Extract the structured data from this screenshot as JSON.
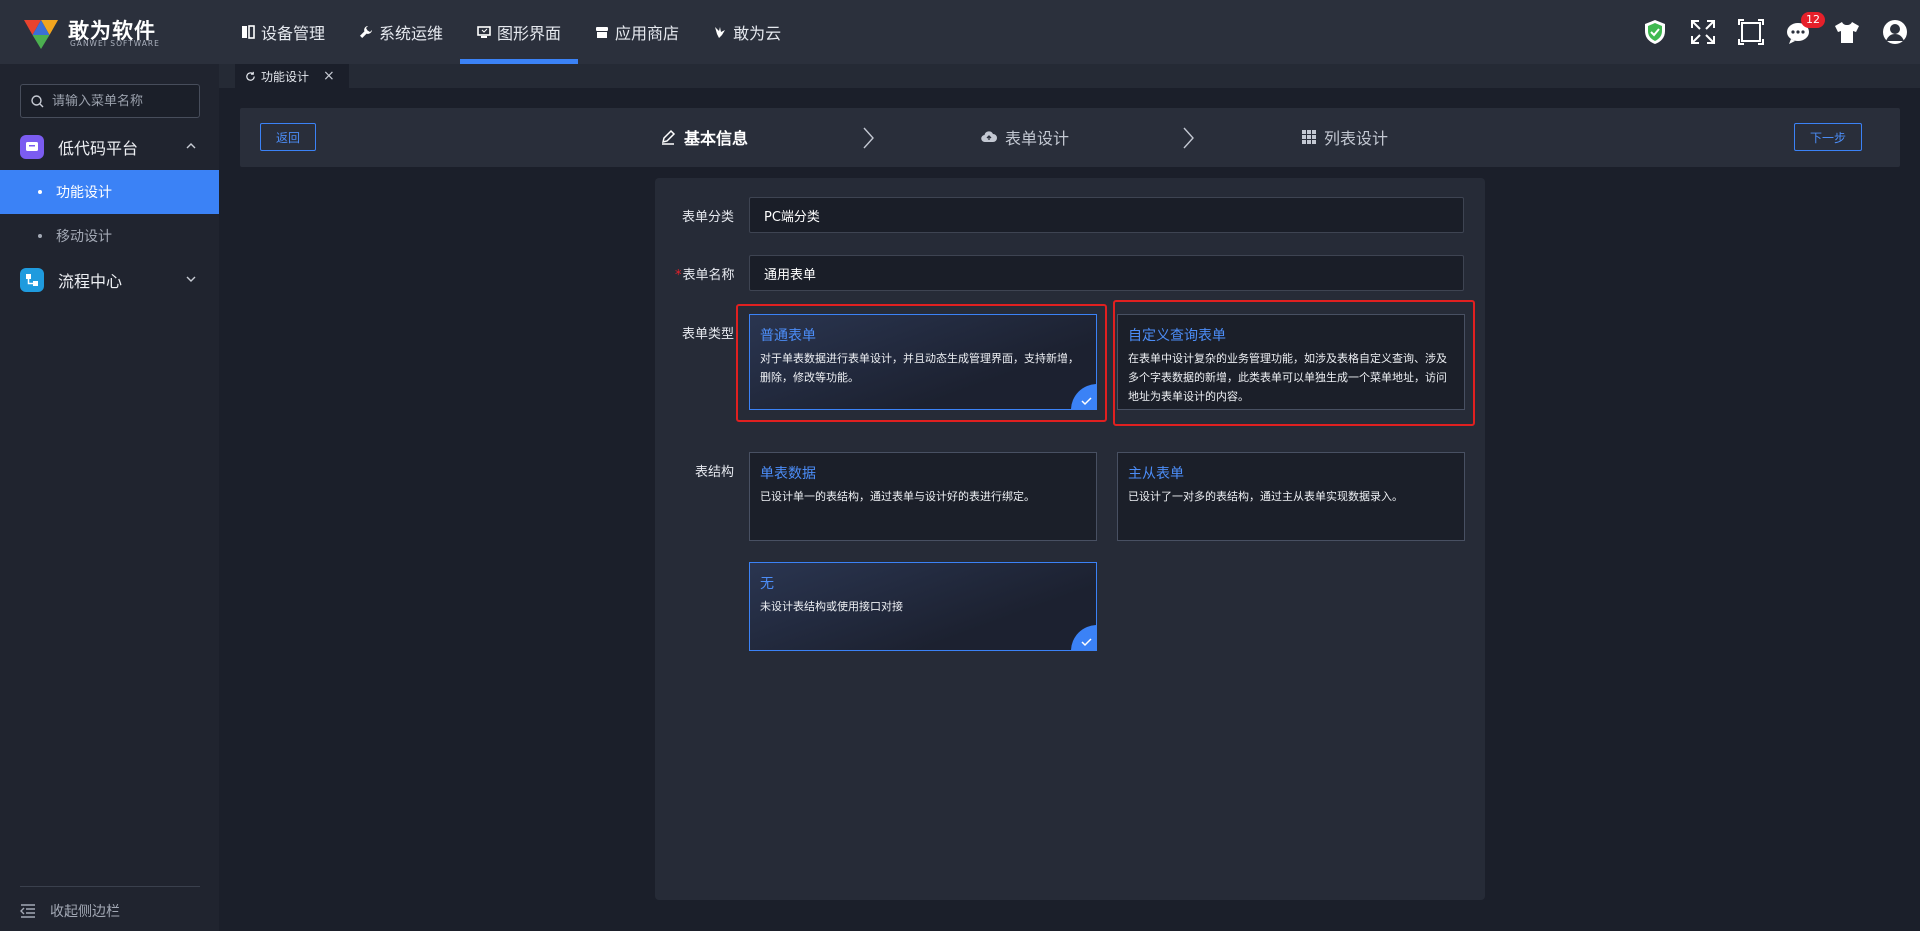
{
  "brand": {
    "name": "敢为软件",
    "sub": "GANWEI SOFTWARE"
  },
  "nav": [
    {
      "label": "设备管理",
      "icon": "book-icon"
    },
    {
      "label": "系统运维",
      "icon": "wrench-icon"
    },
    {
      "label": "图形界面",
      "icon": "monitor-icon",
      "active": true
    },
    {
      "label": "应用商店",
      "icon": "store-icon"
    },
    {
      "label": "敢为云",
      "icon": "bird-icon"
    }
  ],
  "tools": {
    "notification_count": "12"
  },
  "sidebar": {
    "search_placeholder": "请输入菜单名称",
    "groups": [
      {
        "label": "低代码平台",
        "expanded": true,
        "items": [
          "功能设计",
          "移动设计"
        ]
      },
      {
        "label": "流程中心",
        "expanded": false
      }
    ],
    "collapse_label": "收起侧边栏"
  },
  "tabs": [
    {
      "label": "功能设计"
    }
  ],
  "steps": {
    "back_label": "返回",
    "next_label": "下一步",
    "items": [
      "基本信息",
      "表单设计",
      "列表设计"
    ]
  },
  "form": {
    "category_label": "表单分类",
    "category_value": "PC端分类",
    "name_label": "表单名称",
    "name_required": "*",
    "name_value": "通用表单",
    "type_label": "表单类型",
    "types": [
      {
        "title": "普通表单",
        "desc": "对于单表数据进行表单设计，并且动态生成管理界面，支持新增，删除，修改等功能。",
        "selected": true
      },
      {
        "title": "自定义查询表单",
        "desc": "在表单中设计复杂的业务管理功能，如涉及表格自定义查询、涉及多个字表数据的新增，此类表单可以单独生成一个菜单地址，访问地址为表单设计的内容。",
        "selected": false
      }
    ],
    "structure_label": "表结构",
    "structures": [
      {
        "title": "单表数据",
        "desc": "已设计单一的表结构，通过表单与设计好的表进行绑定。",
        "selected": false
      },
      {
        "title": "主从表单",
        "desc": "已设计了一对多的表结构，通过主从表单实现数据录入。",
        "selected": false
      },
      {
        "title": "无",
        "desc": "未设计表结构或使用接口对接",
        "selected": true
      }
    ]
  },
  "colors": {
    "accent": "#3b82f6",
    "highlight": "#e02020",
    "topbar": "#2b303c",
    "sidebar": "#20242f"
  }
}
